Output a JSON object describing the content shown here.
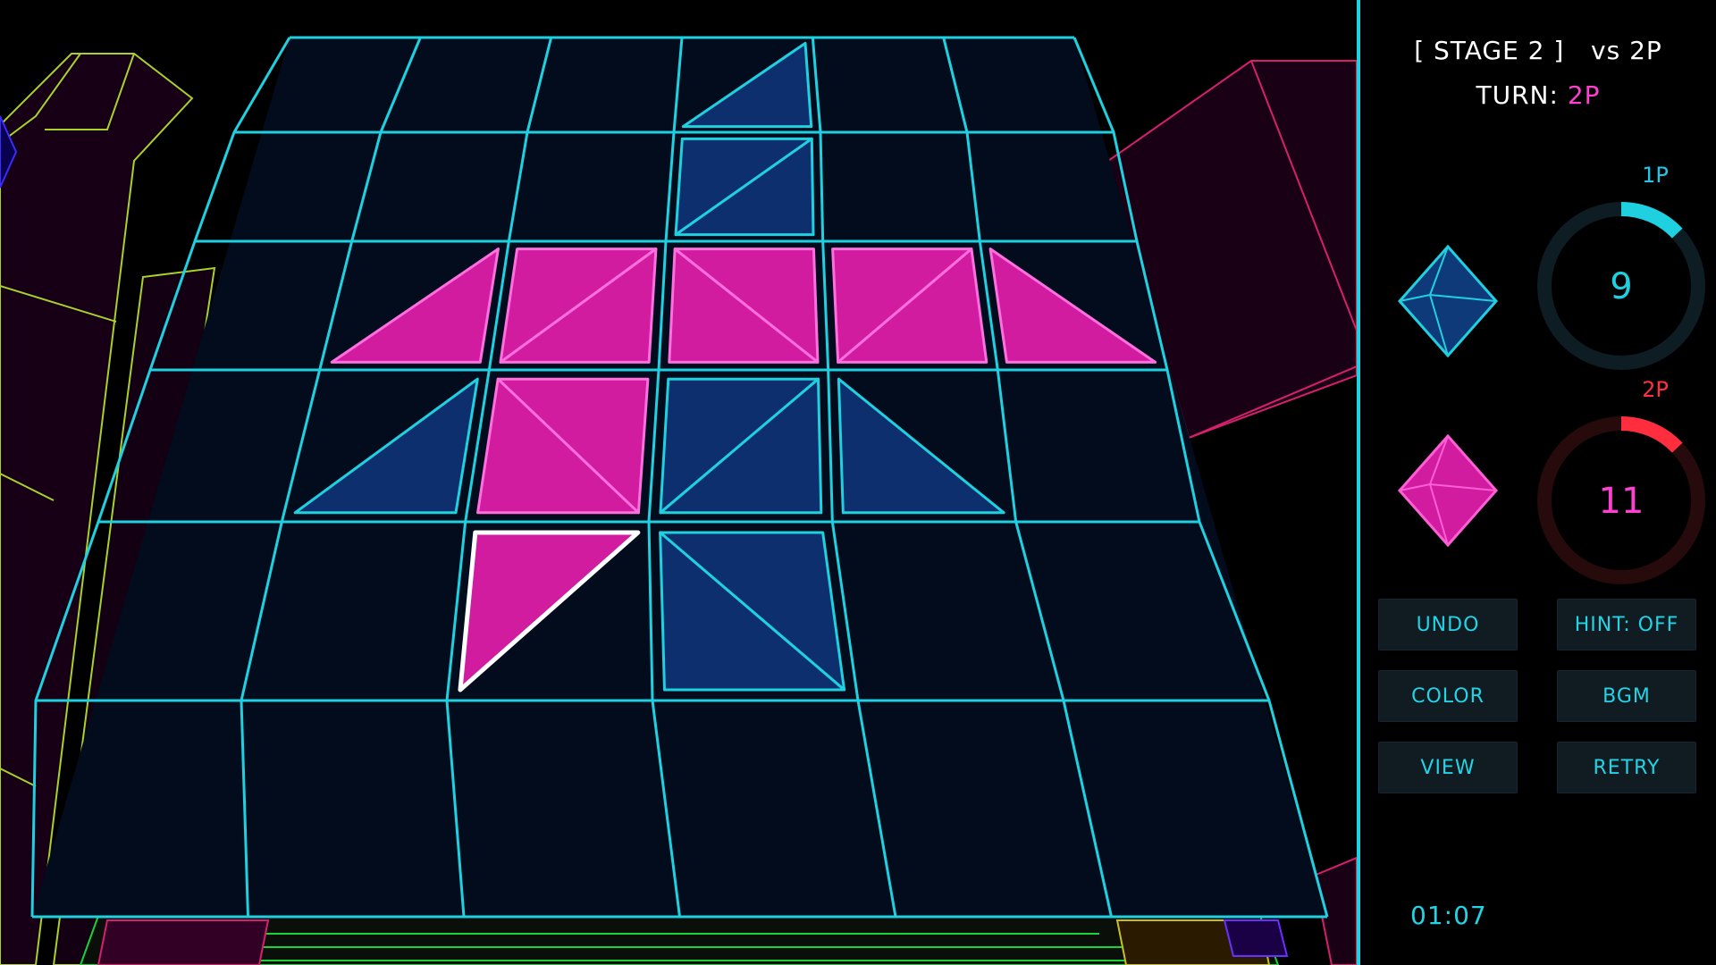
{
  "header": {
    "stage": "[ STAGE 2 ]",
    "mode": "vs 2P",
    "turn_label": "TURN:",
    "turn_value": "2P"
  },
  "players": [
    {
      "label": "1P",
      "score": "9",
      "color": "#1fd1e0",
      "label_color": "#20c8e8",
      "gem_color": "#0e3a7a",
      "progress": 0.13
    },
    {
      "label": "2P",
      "score": "11",
      "color": "#ff2e3f",
      "label_color": "#ff3040",
      "gem_color": "#d21ca0",
      "progress": 0.13
    }
  ],
  "buttons": {
    "undo": "UNDO",
    "hint": "HINT: OFF",
    "color": "COLOR",
    "bgm": "BGM",
    "view": "VIEW",
    "retry": "RETRY"
  },
  "timer": "01:07",
  "colors": {
    "grid": "#1fd1e0",
    "cell_fill": "#030c1c",
    "pink_piece": "#d21ca0",
    "blue_piece": "#0d2f6e",
    "selected_outline": "#ffffff"
  },
  "board": {
    "cols": 6,
    "rows": 6,
    "pieces": [
      {
        "col": 3,
        "row": 0,
        "color": "blue",
        "triangle": "BR"
      },
      {
        "col": 3,
        "row": 1,
        "color": "blue",
        "triangle": "TL"
      },
      {
        "col": 3,
        "row": 1,
        "color": "blue",
        "triangle": "BR"
      },
      {
        "col": 1,
        "row": 2,
        "color": "pink",
        "triangle": "BR"
      },
      {
        "col": 2,
        "row": 2,
        "color": "pink",
        "triangle": "TL"
      },
      {
        "col": 2,
        "row": 2,
        "color": "pink",
        "triangle": "BR"
      },
      {
        "col": 3,
        "row": 2,
        "color": "pink",
        "triangle": "TR"
      },
      {
        "col": 3,
        "row": 2,
        "color": "pink",
        "triangle": "BL"
      },
      {
        "col": 4,
        "row": 2,
        "color": "pink",
        "triangle": "TL"
      },
      {
        "col": 4,
        "row": 2,
        "color": "pink",
        "triangle": "BR"
      },
      {
        "col": 5,
        "row": 2,
        "color": "pink",
        "triangle": "BL"
      },
      {
        "col": 1,
        "row": 3,
        "color": "blue",
        "triangle": "BR"
      },
      {
        "col": 2,
        "row": 3,
        "color": "pink",
        "triangle": "TR"
      },
      {
        "col": 2,
        "row": 3,
        "color": "pink",
        "triangle": "BL"
      },
      {
        "col": 3,
        "row": 3,
        "color": "blue",
        "triangle": "TL"
      },
      {
        "col": 3,
        "row": 3,
        "color": "blue",
        "triangle": "BR"
      },
      {
        "col": 4,
        "row": 3,
        "color": "blue",
        "triangle": "BL"
      },
      {
        "col": 2,
        "row": 4,
        "color": "pink",
        "triangle": "TL",
        "selected": true
      },
      {
        "col": 3,
        "row": 4,
        "color": "blue",
        "triangle": "TR"
      },
      {
        "col": 3,
        "row": 4,
        "color": "blue",
        "triangle": "BL"
      }
    ]
  }
}
